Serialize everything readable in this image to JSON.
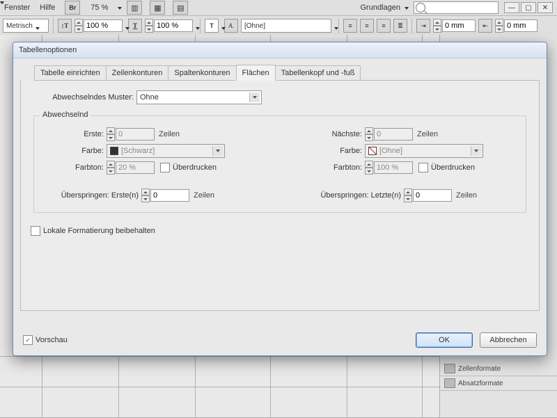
{
  "menubar": {
    "fenster": "Fenster",
    "hilfe": "Hilfe",
    "br": "Br",
    "zoom": "75 %",
    "workspace": "Grundlagen"
  },
  "toolbar2": {
    "units": "Metrisch",
    "scaleX": "100 %",
    "scaleY": "100 %",
    "charstyle": "[Ohne]",
    "left_mm": "0 mm",
    "right_mm": "0 mm"
  },
  "dialog": {
    "title": "Tabellenoptionen",
    "tabs": {
      "t1": "Tabelle einrichten",
      "t2": "Zeilenkonturen",
      "t3": "Spaltenkonturen",
      "t4": "Flächen",
      "t5": "Tabellenkopf und -fuß"
    },
    "pattern_label": "Abwechselndes Muster:",
    "pattern_value": "Ohne",
    "fieldset_legend": "Abwechselnd",
    "left": {
      "erste_label": "Erste:",
      "erste_value": "0",
      "zeilen": "Zeilen",
      "farbe_label": "Farbe:",
      "farbe_value": "[Schwarz]",
      "farbton_label": "Farbton:",
      "farbton_value": "20 %",
      "overprint": "Überdrucken"
    },
    "right": {
      "naechste_label": "Nächste:",
      "naechste_value": "0",
      "zeilen": "Zeilen",
      "farbe_label": "Farbe:",
      "farbe_value": "[Ohne]",
      "farbton_label": "Farbton:",
      "farbton_value": "100 %",
      "overprint": "Überdrucken"
    },
    "skip_first_label": "Überspringen: Erste(n)",
    "skip_first_value": "0",
    "skip_first_unit": "Zeilen",
    "skip_last_label": "Überspringen: Letzte(n)",
    "skip_last_value": "0",
    "skip_last_unit": "Zeilen",
    "local_fmt": "Lokale Formatierung beibehalten",
    "preview": "Vorschau",
    "ok": "OK",
    "cancel": "Abbrechen"
  },
  "panels": {
    "zellen": "Zellenformate",
    "absatz": "Absatzformate"
  }
}
